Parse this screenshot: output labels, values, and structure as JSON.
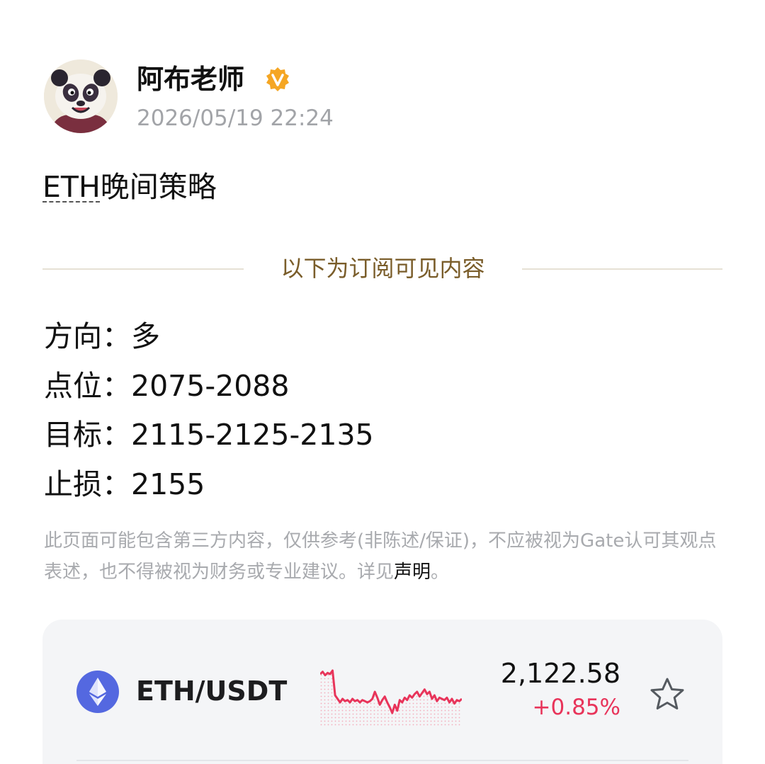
{
  "author": {
    "name": "阿布老师",
    "timestamp": "2026/05/19 22:24"
  },
  "post": {
    "title_ticker": "ETH",
    "title_rest": "晚间策略",
    "subscriber_divider": "以下为订阅可见内容",
    "strategy": [
      {
        "label": "方向：",
        "value": "多"
      },
      {
        "label": "点位：",
        "value": "2075-2088"
      },
      {
        "label": "目标：",
        "value": "2115-2125-2135"
      },
      {
        "label": "止损：",
        "value": "2155"
      }
    ],
    "disclaimer": "此页面可能包含第三方内容，仅供参考(非陈述/保证)，不应被视为Gate认可其观点表述，也不得被视为财务或专业建议。详见",
    "disclaimer_link": "声明",
    "disclaimer_end": "。"
  },
  "ticker": {
    "pair": "ETH/USDT",
    "price": "2,122.58",
    "change": "+0.85%",
    "icon": "ethereum-icon",
    "sparkline_color": "#e8345a",
    "sparkline_values": [
      2134,
      2136,
      2133,
      2135,
      2134,
      2137,
      2116,
      2113,
      2110,
      2113,
      2111,
      2112,
      2110,
      2113,
      2111,
      2112,
      2110,
      2112,
      2111,
      2110,
      2111,
      2113,
      2119,
      2114,
      2108,
      2112,
      2115,
      2110,
      2106,
      2101,
      2108,
      2103,
      2112,
      2110,
      2114,
      2112,
      2116,
      2114,
      2117,
      2119,
      2115,
      2118,
      2121,
      2117,
      2119,
      2113,
      2116,
      2111,
      2114,
      2113,
      2112,
      2114,
      2110,
      2113,
      2109,
      2112,
      2111,
      2113
    ]
  },
  "colors": {
    "accent_gold": "#7a5d2a",
    "verified_badge": "#f5a623",
    "negative_change": "#e8345a"
  }
}
